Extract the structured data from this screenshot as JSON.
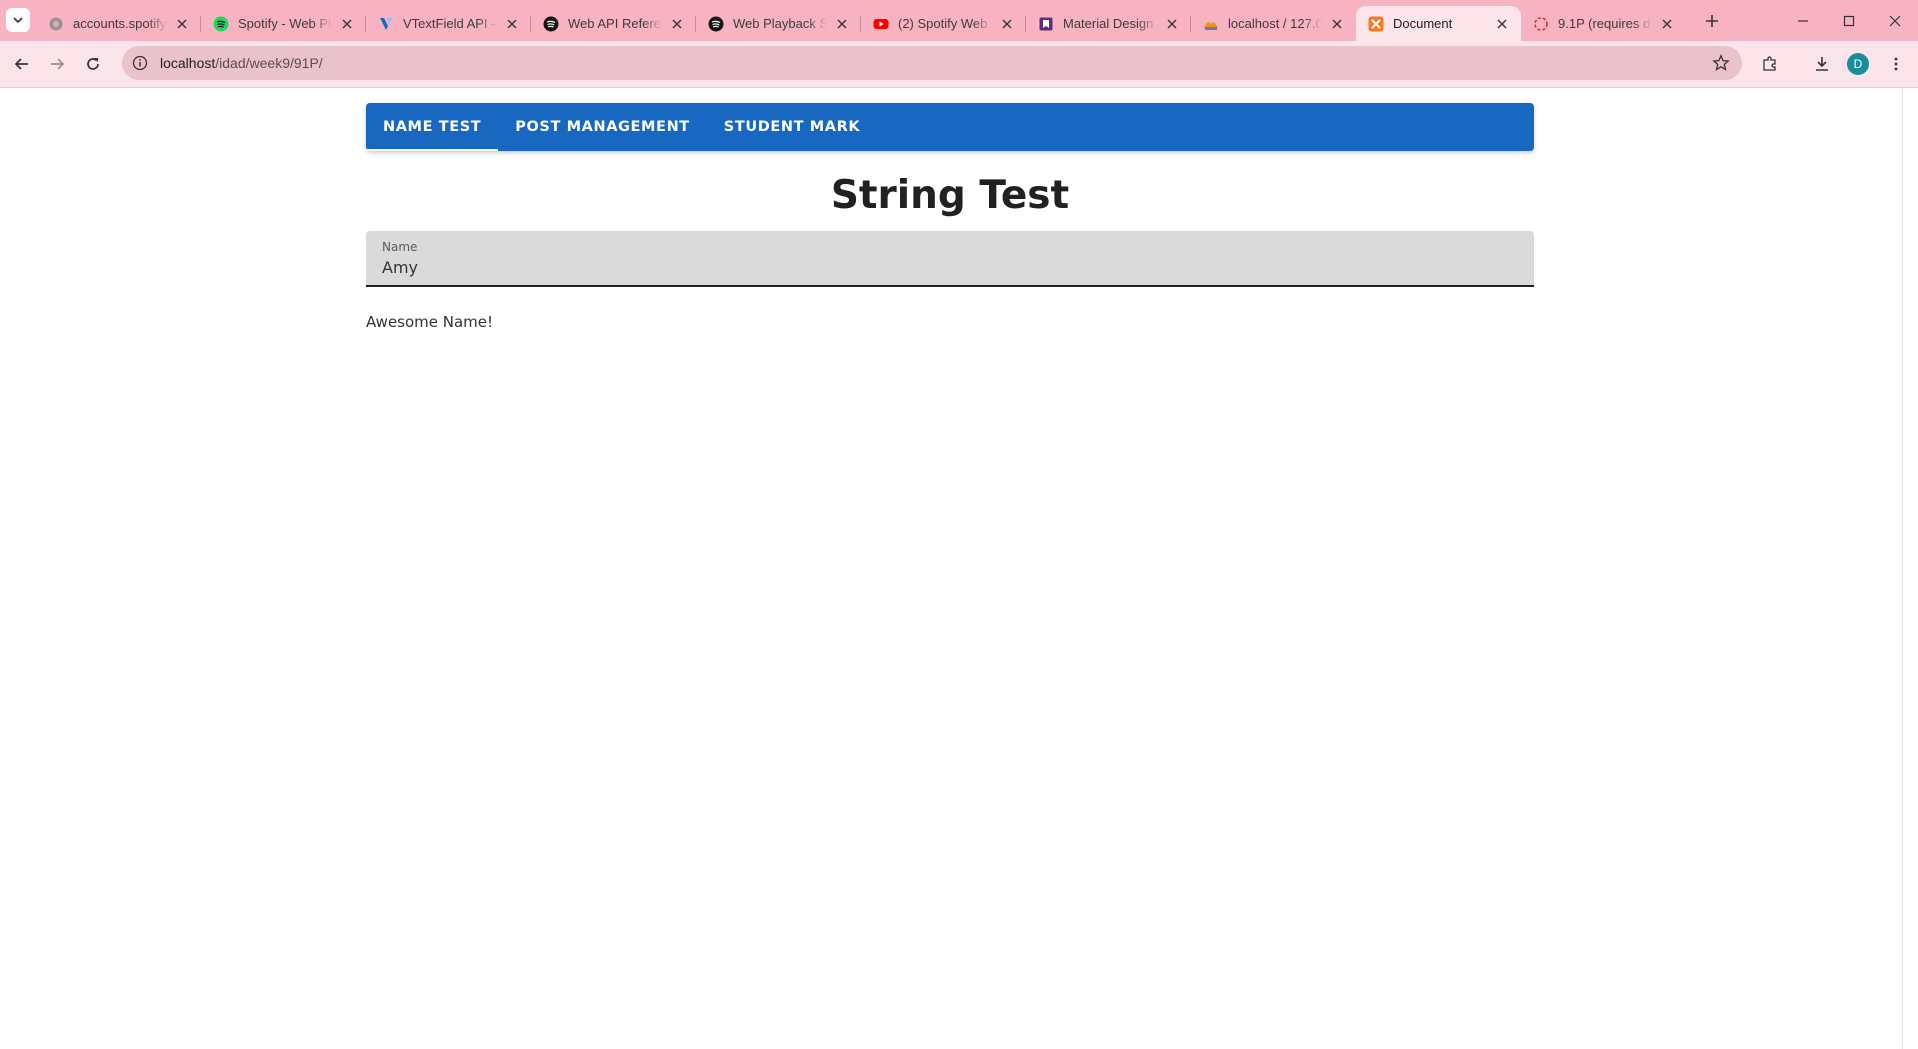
{
  "browser": {
    "tabs": [
      {
        "title": "accounts.spotify.com",
        "icon": "globe-icon"
      },
      {
        "title": "Spotify - Web Player",
        "icon": "spotify-icon"
      },
      {
        "title": "VTextField API — Vuetify",
        "icon": "vuetify-icon"
      },
      {
        "title": "Web API Reference",
        "icon": "spotify-icon"
      },
      {
        "title": "Web Playback SDK",
        "icon": "spotify-icon"
      },
      {
        "title": "(2) Spotify Web API",
        "icon": "youtube-icon"
      },
      {
        "title": "Material Design Icons",
        "icon": "material-design-icon"
      },
      {
        "title": "localhost / 127.0.0.1",
        "icon": "phpmyadmin-icon"
      },
      {
        "title": "Document",
        "icon": "xampp-icon",
        "active": true
      },
      {
        "title": "9.1P (requires demo)",
        "icon": "loading-icon"
      }
    ],
    "url_host": "localhost",
    "url_path": "/idad/week9/91P/",
    "profile_initial": "D"
  },
  "app": {
    "nav_tabs": [
      {
        "label": "NAME TEST",
        "active": true
      },
      {
        "label": "POST MANAGEMENT"
      },
      {
        "label": "STUDENT MARK"
      }
    ],
    "heading": "String Test",
    "field_label": "Name",
    "field_value": "Amy",
    "message": "Awesome Name!"
  },
  "colors": {
    "tabstrip": "#f7b3c1",
    "toolbar": "#fbe4ea",
    "nav_primary": "#1867c0",
    "field_bg": "#dadada"
  }
}
